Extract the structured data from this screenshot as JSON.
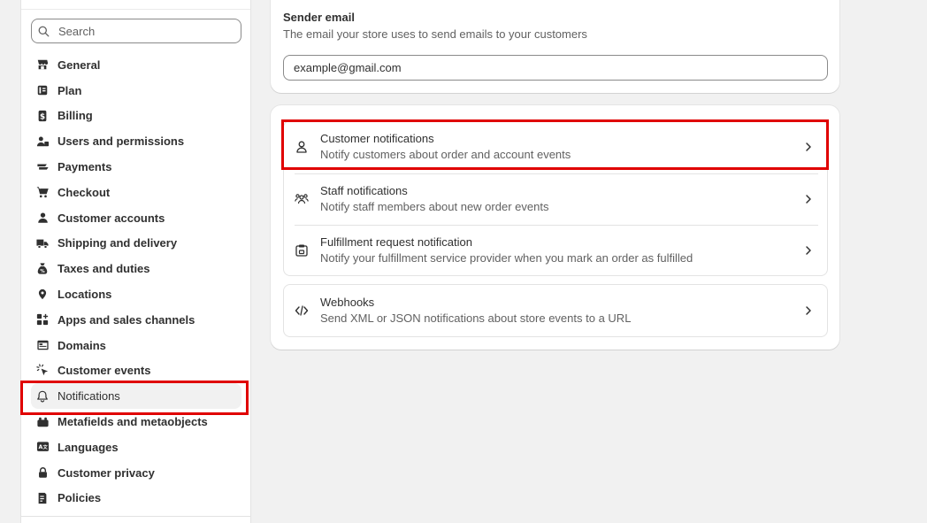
{
  "sidebar": {
    "search_placeholder": "Search",
    "items": [
      {
        "label": "General",
        "icon": "store-icon"
      },
      {
        "label": "Plan",
        "icon": "plan-icon"
      },
      {
        "label": "Billing",
        "icon": "billing-icon"
      },
      {
        "label": "Users and permissions",
        "icon": "users-icon"
      },
      {
        "label": "Payments",
        "icon": "payments-icon"
      },
      {
        "label": "Checkout",
        "icon": "cart-icon"
      },
      {
        "label": "Customer accounts",
        "icon": "person-icon"
      },
      {
        "label": "Shipping and delivery",
        "icon": "truck-icon"
      },
      {
        "label": "Taxes and duties",
        "icon": "taxes-icon"
      },
      {
        "label": "Locations",
        "icon": "location-pin-icon"
      },
      {
        "label": "Apps and sales channels",
        "icon": "apps-icon"
      },
      {
        "label": "Domains",
        "icon": "domains-icon"
      },
      {
        "label": "Customer events",
        "icon": "cursor-click-icon"
      },
      {
        "label": "Notifications",
        "icon": "bell-icon",
        "active": true
      },
      {
        "label": "Metafields and metaobjects",
        "icon": "metafields-icon"
      },
      {
        "label": "Languages",
        "icon": "language-icon"
      },
      {
        "label": "Customer privacy",
        "icon": "lock-icon"
      },
      {
        "label": "Policies",
        "icon": "policies-icon"
      }
    ]
  },
  "sender": {
    "title": "Sender email",
    "description": "The email your store uses to send emails to your customers",
    "value": "example@gmail.com"
  },
  "notifications": {
    "rows": [
      {
        "title": "Customer notifications",
        "description": "Notify customers about order and account events",
        "icon": "person-outline-icon"
      },
      {
        "title": "Staff notifications",
        "description": "Notify staff members about new order events",
        "icon": "team-icon"
      },
      {
        "title": "Fulfillment request notification",
        "description": "Notify your fulfillment service provider when you mark an order as fulfilled",
        "icon": "fulfillment-icon"
      }
    ],
    "webhooks": {
      "title": "Webhooks",
      "description": "Send XML or JSON notifications about store events to a URL",
      "icon": "code-icon"
    }
  },
  "colors": {
    "highlight": "#e00000",
    "text": "#303030",
    "subdued": "#616161",
    "background": "#f1f1f1"
  }
}
